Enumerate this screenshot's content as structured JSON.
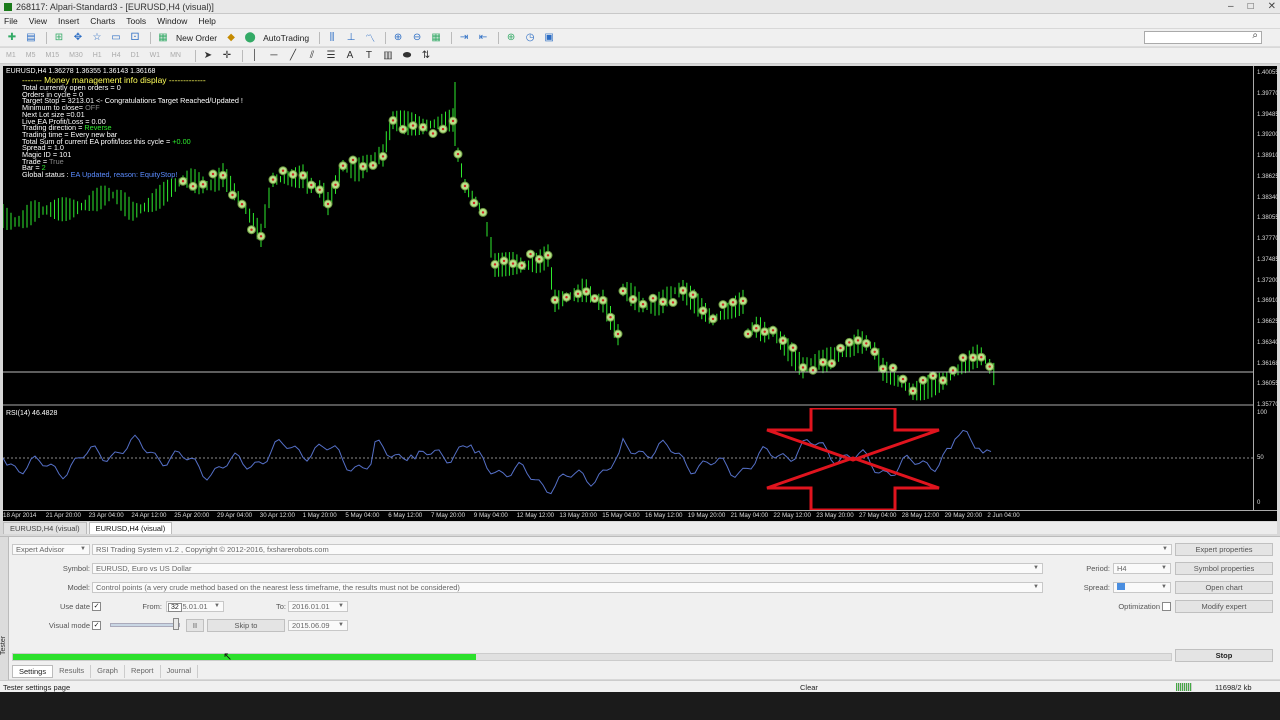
{
  "window": {
    "title": "268117: Alpari-Standard3 - [EURUSD,H4 (visual)]"
  },
  "menu": [
    "File",
    "View",
    "Insert",
    "Charts",
    "Tools",
    "Window",
    "Help"
  ],
  "toolbar": {
    "new_order": "New Order",
    "auto_trading": "AutoTrading"
  },
  "timeframes": [
    "M1",
    "M5",
    "M15",
    "M30",
    "H1",
    "H4",
    "D1",
    "W1",
    "MN"
  ],
  "chart": {
    "symbol_header": "EURUSD,H4  1.36278 1.36355 1.36143 1.36168",
    "info_lines": {
      "header": "------- Money management info display -------------",
      "l1": "Total currently open orders = 0",
      "l2": "Orders in cycle = 0",
      "l3a": "Target Stop = 3213.01",
      "l3b": " <- Congratulations Target Reached/Updated !",
      "l4a": "Minimum to close= ",
      "l4b": "OFF",
      "l5": "Next Lot size =0.01",
      "l6": "Live EA Profit/Loss = 0.00",
      "l7a": "Trading direction = ",
      "l7b": "Reverse",
      "l8": "Trading time = Every new bar",
      "l9a": "Total Sum of current EA profit/loss this cycle = ",
      "l9b": "+0.00",
      "l10": "Spread = 1.0",
      "l11": "Magic ID = 101",
      "l12a": "Trade = ",
      "l12b": "True",
      "l13a": "Bar = ",
      "l13b": "2",
      "l14a": "Global status : ",
      "l14b": "EA Updated, reason: EquityStop!"
    },
    "rsi_label": "RSI(14) 46.4828",
    "price_ticks": [
      "1.40055",
      "1.39770",
      "1.39485",
      "1.39200",
      "1.38910",
      "1.38625",
      "1.38340",
      "1.38055",
      "1.37770",
      "1.37485",
      "1.37200",
      "1.36910",
      "1.36625",
      "1.36340",
      "1.36168",
      "1.36055",
      "1.35770"
    ],
    "rsi_ticks": [
      "100",
      "50",
      "0"
    ],
    "time_ticks": [
      "18 Apr 2014",
      "21 Apr 20:00",
      "23 Apr 04:00",
      "24 Apr 12:00",
      "25 Apr 20:00",
      "29 Apr 04:00",
      "30 Apr 12:00",
      "1 May 20:00",
      "5 May 04:00",
      "6 May 12:00",
      "7 May 20:00",
      "9 May 04:00",
      "12 May 12:00",
      "13 May 20:00",
      "15 May 04:00",
      "16 May 12:00",
      "19 May 20:00",
      "21 May 04:00",
      "22 May 12:00",
      "23 May 20:00",
      "27 May 04:00",
      "28 May 12:00",
      "29 May 20:00",
      "2 Jun 04:00"
    ],
    "colors": {
      "bars": "#2eea2e",
      "background": "#000000",
      "rsi_line": "#5570c8",
      "annotation": "#e0141e"
    }
  },
  "chart_tabs": [
    "EURUSD,H4 (visual)",
    "EURUSD,H4 (visual)"
  ],
  "tester": {
    "side_label": "Tester",
    "type": "Expert Advisor",
    "ea_name": "RSI Trading System v1.2 , Copyright © 2012-2016, fxsharerobots.com",
    "symbol_label": "Symbol:",
    "symbol_value": "EURUSD, Euro vs US Dollar",
    "model_label": "Model:",
    "model_value": "Control points (a very crude method based on the nearest less timeframe, the results must not be considered)",
    "use_date_label": "Use date",
    "from_label": "From:",
    "from_value": "2015.01.01",
    "from_tooltip": "32",
    "to_label": "To:",
    "to_value": "2016.01.01",
    "visual_mode_label": "Visual mode",
    "pause_label": "II",
    "skip_to_label": "Skip to",
    "skip_to_value": "2015.06.09",
    "period_label": "Period:",
    "period_value": "H4",
    "spread_label": "Spread:",
    "optimization_label": "Optimization",
    "buttons": [
      "Expert properties",
      "Symbol properties",
      "Open chart",
      "Modify expert"
    ],
    "stop_label": "Stop",
    "progress": 0.4,
    "tabs": [
      "Settings",
      "Results",
      "Graph",
      "Report",
      "Journal"
    ]
  },
  "status": {
    "left": "Tester settings page",
    "mid": "Clear",
    "right": "11698/2 kb"
  }
}
